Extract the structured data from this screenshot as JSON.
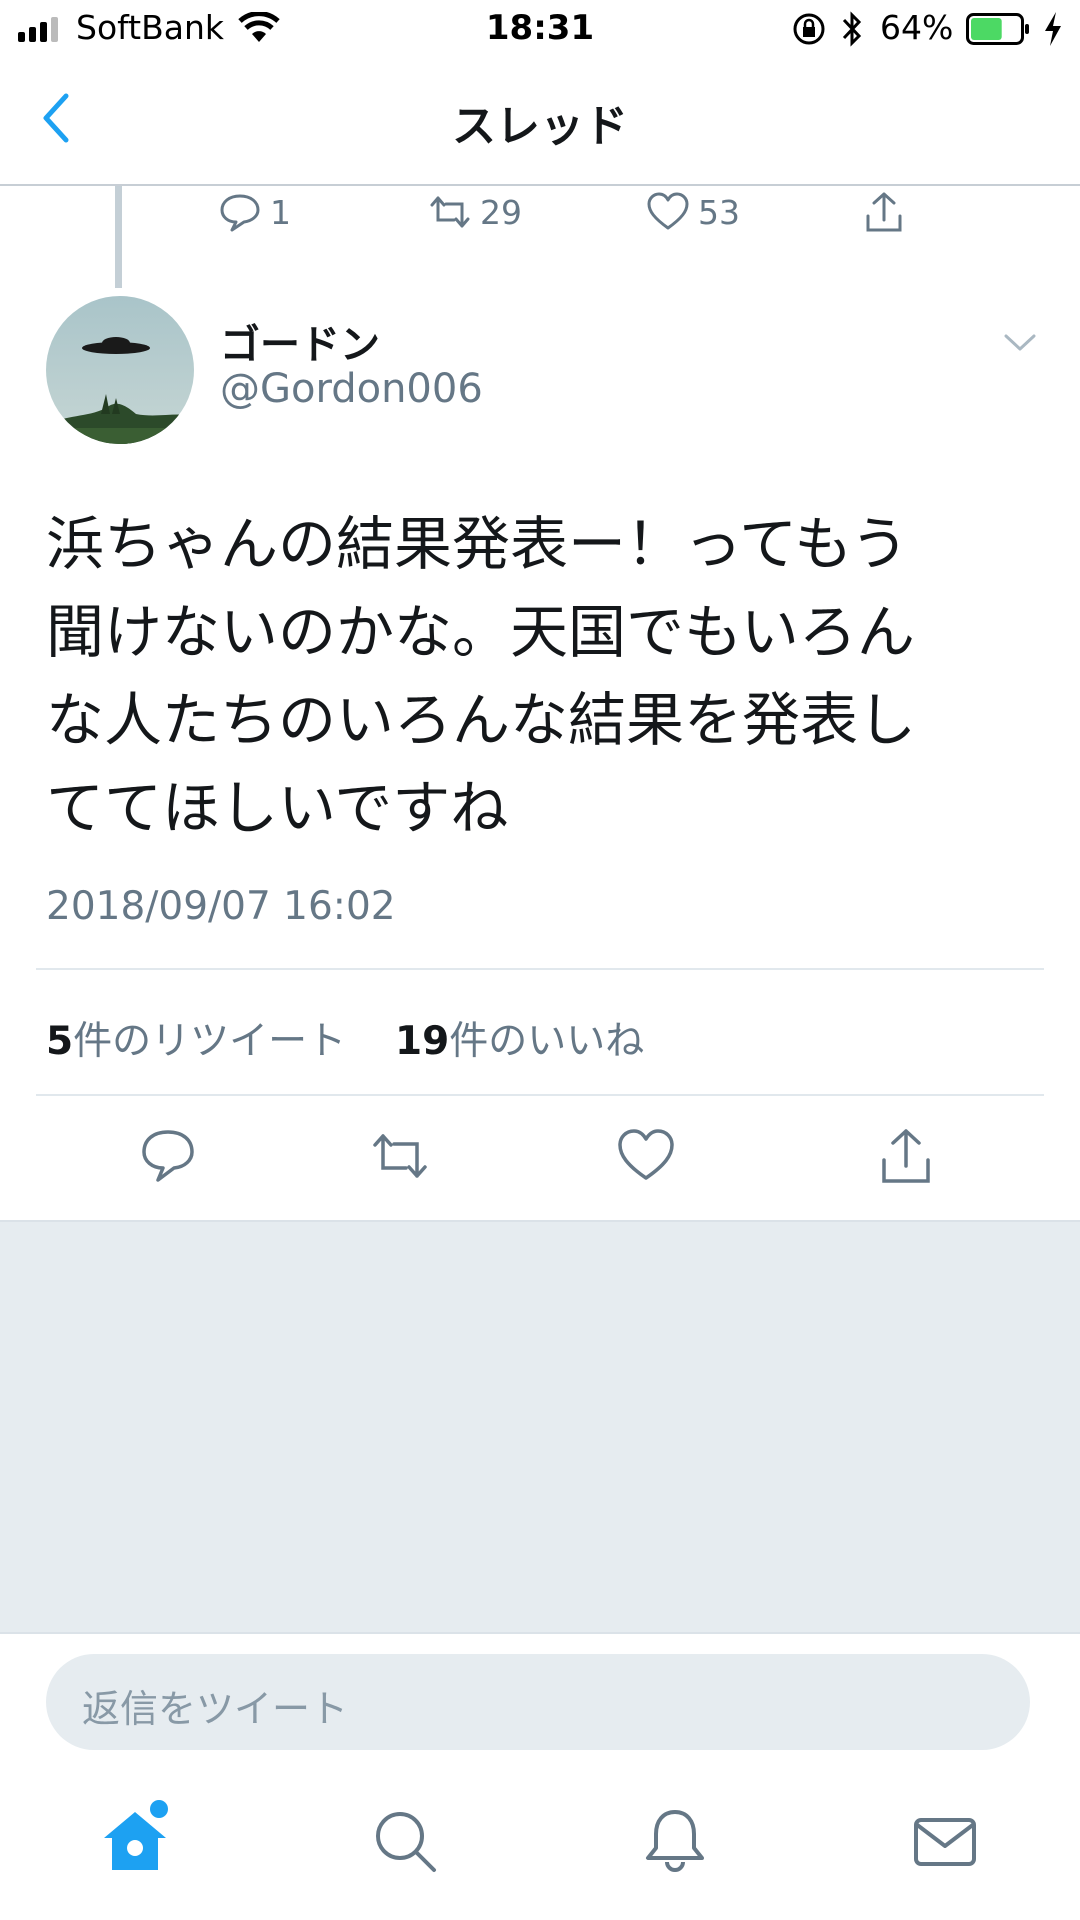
{
  "status_bar": {
    "carrier": "SoftBank",
    "time": "18:31",
    "battery_percent": "64%",
    "battery_level": 0.64,
    "icons": [
      "signal-icon",
      "wifi-icon",
      "rotation-lock-icon",
      "bluetooth-icon",
      "battery-icon",
      "charging-icon"
    ]
  },
  "nav": {
    "title": "スレッド",
    "back_icon": "chevron-left-icon"
  },
  "prev_tweet_actions": {
    "replies": "1",
    "retweets": "29",
    "likes": "53"
  },
  "tweet": {
    "display_name": "ゴードン",
    "handle": "@Gordon006",
    "text": "浜ちゃんの結果発表ー！ってもう\n聞けないのかな。天国でもいろん\nな人たちのいろんな結果を発表し\nてて​ほしいですね",
    "timestamp": "2018/09/07 16:02",
    "retweet_count": "5",
    "retweet_label": "件のリツイート",
    "like_count": "19",
    "like_label": "件のいいね"
  },
  "reply": {
    "placeholder": "返信をツイート"
  },
  "tab_bar": {
    "tabs": [
      "home-icon",
      "search-icon",
      "notifications-icon",
      "messages-icon"
    ]
  },
  "colors": {
    "accent": "#1da1f2",
    "secondary_text": "#657786",
    "background_gray": "#e6ecf0",
    "battery_green": "#4cd964"
  }
}
